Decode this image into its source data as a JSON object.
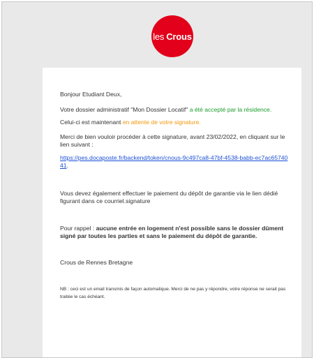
{
  "logo": {
    "part1": "les",
    "part2": "Crous",
    "color": "#e2001a"
  },
  "email": {
    "greeting": "Bonjour Etudiant Deux,",
    "p1_a": "Votre dossier administratif \"Mon Dossier Locatif\"",
    "p1_b": "a été accepté par la résidence",
    "p1_c": ".",
    "p2_a": "Celui-ci est maintenant",
    "p2_b": "en attente de votre signature",
    "p2_c": ".",
    "p3": "Merci de bien vouloir procéder à cette signature, avant 23/02/2022, en cliquant sur le lien suivant :",
    "link": "https://pes.docaposte.fr/backend/token/cnous-9c497ca8-47bf-4538-babb-ec7ac6574041",
    "link_end": ".",
    "p4": "Vous devez également effectuer le paiement du dépôt de garantie via le lien dédié figurant dans ce courriel.signature",
    "p5_a": "Pour rappel :",
    "p5_b": "aucune entrée en logement n'est possible sans le dossier dûment signé par toutes les parties et sans le paiement du dépôt de garantie.",
    "signature": "Crous de Rennes Bretagne",
    "nb": "NB : ceci est un email transmis de façon automatique. Merci de ne pas y répondre, votre réponse ne serait pas traitée le cas échéant."
  },
  "colors": {
    "accepted": "#1a9c2a",
    "pending": "#f0960a",
    "link": "#1a4fd6"
  }
}
